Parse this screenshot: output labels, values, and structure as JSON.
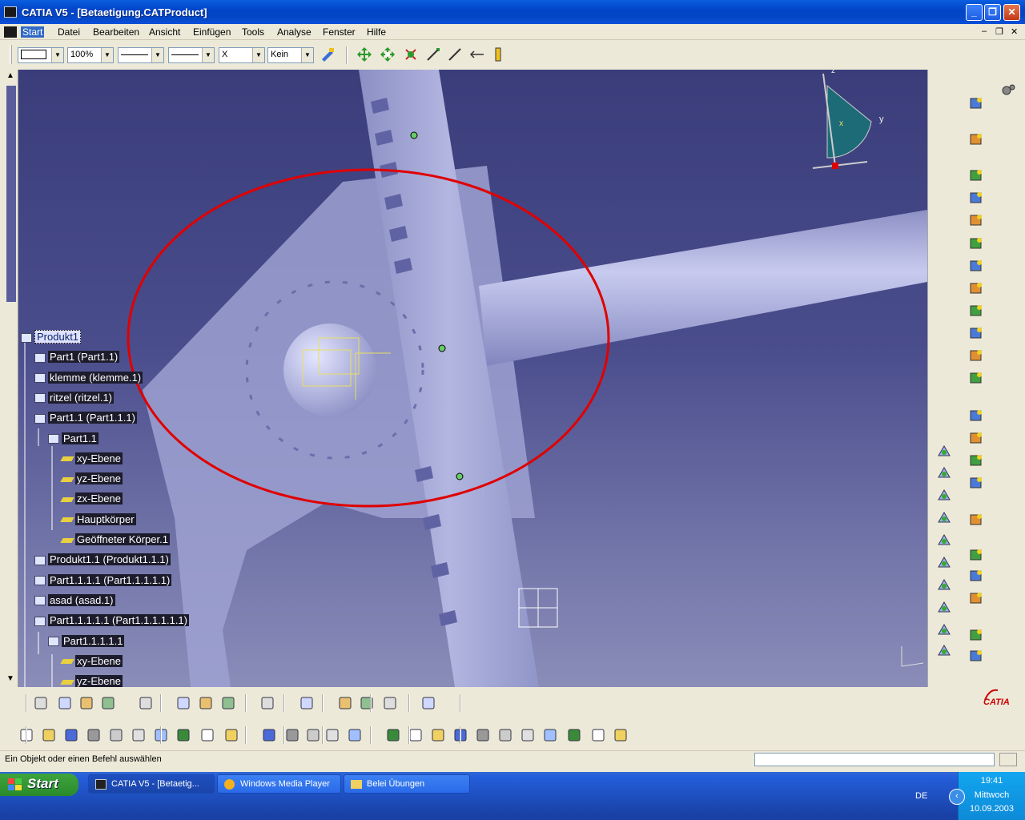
{
  "window": {
    "title": "CATIA V5 - [Betaetigung.CATProduct]"
  },
  "menu": [
    "Start",
    "Datei",
    "Bearbeiten",
    "Ansicht",
    "Einfügen",
    "Tools",
    "Analyse",
    "Fenster",
    "Hilfe"
  ],
  "toolbar": {
    "zoom": "100%",
    "linetype": "X",
    "layer": "Kein"
  },
  "tree": [
    {
      "label": "Produkt1",
      "indent": 0,
      "selected": true
    },
    {
      "label": "Part1 (Part1.1)",
      "indent": 1
    },
    {
      "label": "klemme (klemme.1)",
      "indent": 1
    },
    {
      "label": "ritzel (ritzel.1)",
      "indent": 1
    },
    {
      "label": "Part1.1 (Part1.1.1)",
      "indent": 1
    },
    {
      "label": "Part1.1",
      "indent": 2
    },
    {
      "label": "xy-Ebene",
      "indent": 3
    },
    {
      "label": "yz-Ebene",
      "indent": 3
    },
    {
      "label": "zx-Ebene",
      "indent": 3
    },
    {
      "label": "Hauptkörper",
      "indent": 3
    },
    {
      "label": "Geöffneter Körper.1",
      "indent": 3
    },
    {
      "label": "Produkt1.1 (Produkt1.1.1)",
      "indent": 1
    },
    {
      "label": "Part1.1.1.1 (Part1.1.1.1.1)",
      "indent": 1
    },
    {
      "label": "asad (asad.1)",
      "indent": 1
    },
    {
      "label": "Part1.1.1.1.1 (Part1.1.1.1.1.1)",
      "indent": 1
    },
    {
      "label": "Part1.1.1.1.1",
      "indent": 2
    },
    {
      "label": "xy-Ebene",
      "indent": 3
    },
    {
      "label": "yz-Ebene",
      "indent": 3
    }
  ],
  "compass": {
    "z": "z",
    "y": "y",
    "x": "x"
  },
  "status": {
    "text": "Ein Objekt oder einen Befehl auswählen"
  },
  "taskbar": {
    "start": "Start",
    "tasks": [
      "CATIA V5 - [Betaetig...",
      "Windows Media Player",
      "Belei Übungen"
    ],
    "lang": "DE",
    "time": "19:41",
    "day": "Mittwoch",
    "date": "10.09.2003"
  },
  "logo": "CATIA",
  "colors": {
    "highlight": "#e00000",
    "viewport_top": "#3a3d7a",
    "selection": "#0a246a"
  }
}
